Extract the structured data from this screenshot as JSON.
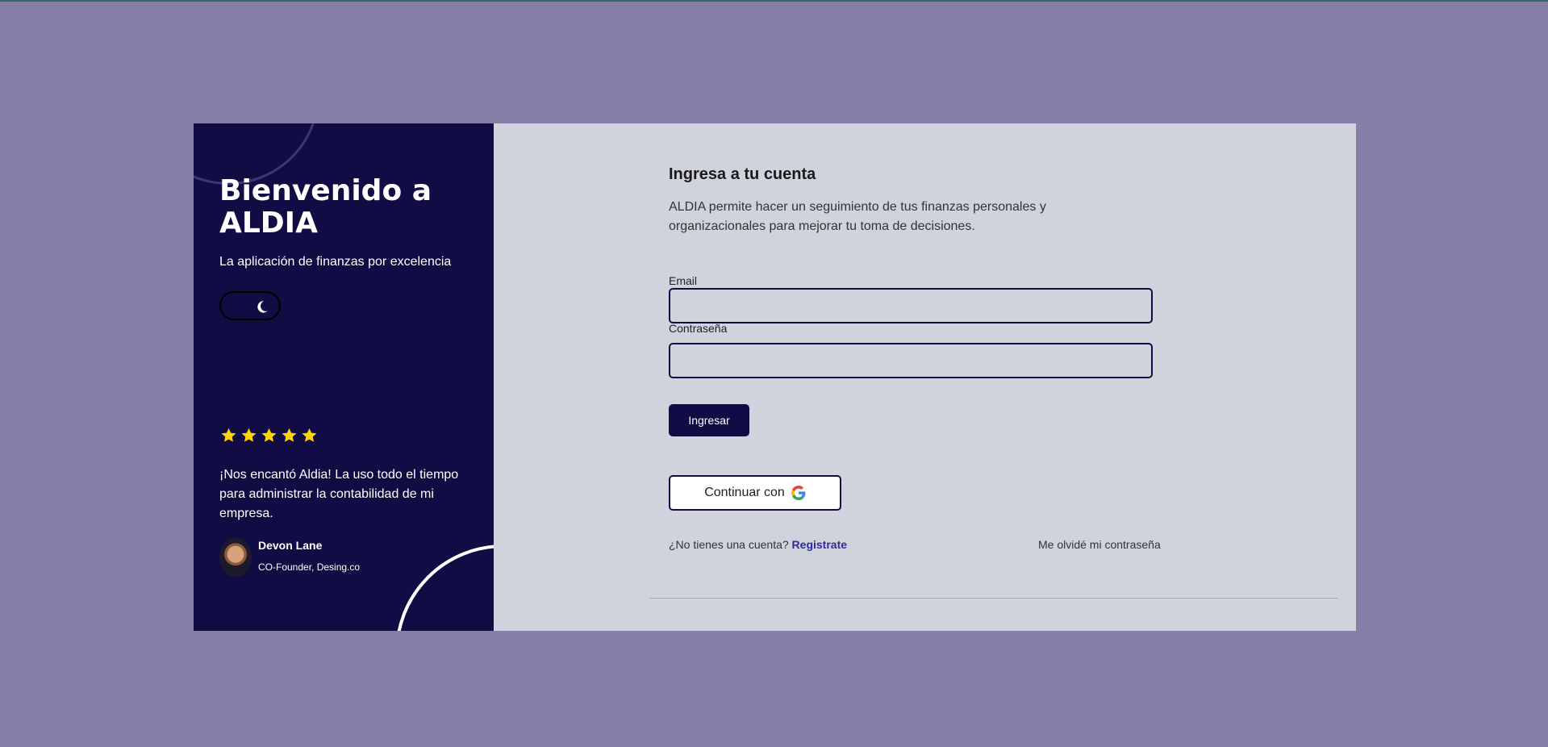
{
  "colors": {
    "background": "#877ea8",
    "sidebar": "#120c44",
    "panel": "#d0d3dc",
    "star": "#ffd400",
    "link": "#2d2a9e"
  },
  "sidebar": {
    "title": "Bienvenido a ALDIA",
    "subtitle": "La aplicación de finanzas por excelencia",
    "theme_toggle_icon": "moon-icon",
    "rating": 5,
    "testimonial": "¡Nos encantó Aldia! La uso todo el tiempo para administrar la contabilidad de mi empresa.",
    "author": {
      "name": "Devon Lane",
      "role": "CO-Founder, Desing.co"
    }
  },
  "form": {
    "title": "Ingresa a tu cuenta",
    "description": "ALDIA permite hacer un seguimiento de tus finanzas personales y organizacionales para mejorar tu toma de decisiones.",
    "email_label": "Email",
    "email_value": "",
    "password_label": "Contraseña",
    "password_value": "",
    "submit_label": "Ingresar",
    "google_label": "Continuar con",
    "signup_prompt": "¿No tienes una cuenta?",
    "signup_link": "Registrate",
    "forgot_link": "Me olvidé mi contraseña"
  }
}
